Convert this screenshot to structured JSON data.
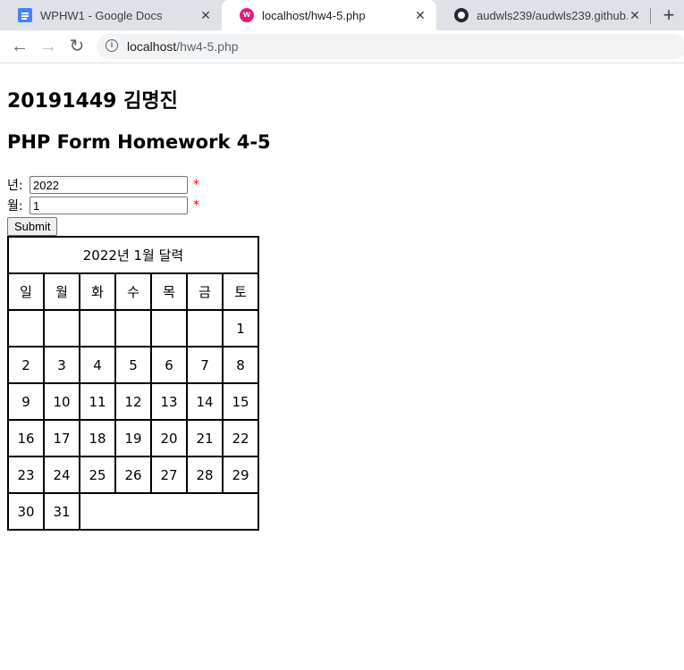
{
  "browser": {
    "tabs": [
      {
        "title": "WPHW1 - Google Docs",
        "icon": "google-docs-icon"
      },
      {
        "title": "localhost/hw4-5.php",
        "icon": "wampserver-icon"
      },
      {
        "title": "audwls239/audwls239.github.io",
        "icon": "github-icon"
      }
    ],
    "new_tab": "+",
    "close": "✕",
    "url_host": "localhost",
    "url_path": "/hw4-5.php"
  },
  "page": {
    "heading": "20191449 김명진",
    "subheading": "PHP Form Homework 4-5",
    "form": {
      "year_label": "년:",
      "year_value": "2022",
      "month_label": "월:",
      "month_value": "1",
      "required_mark": "*",
      "submit_label": "Submit"
    },
    "calendar": {
      "caption": "2022년 1월 달력",
      "weekdays": [
        "일",
        "월",
        "화",
        "수",
        "목",
        "금",
        "토"
      ],
      "weeks": [
        [
          "",
          "",
          "",
          "",
          "",
          "",
          "1"
        ],
        [
          "2",
          "3",
          "4",
          "5",
          "6",
          "7",
          "8"
        ],
        [
          "9",
          "10",
          "11",
          "12",
          "13",
          "14",
          "15"
        ],
        [
          "16",
          "17",
          "18",
          "19",
          "20",
          "21",
          "22"
        ],
        [
          "23",
          "24",
          "25",
          "26",
          "27",
          "28",
          "29"
        ],
        [
          "30",
          "31"
        ]
      ]
    }
  }
}
